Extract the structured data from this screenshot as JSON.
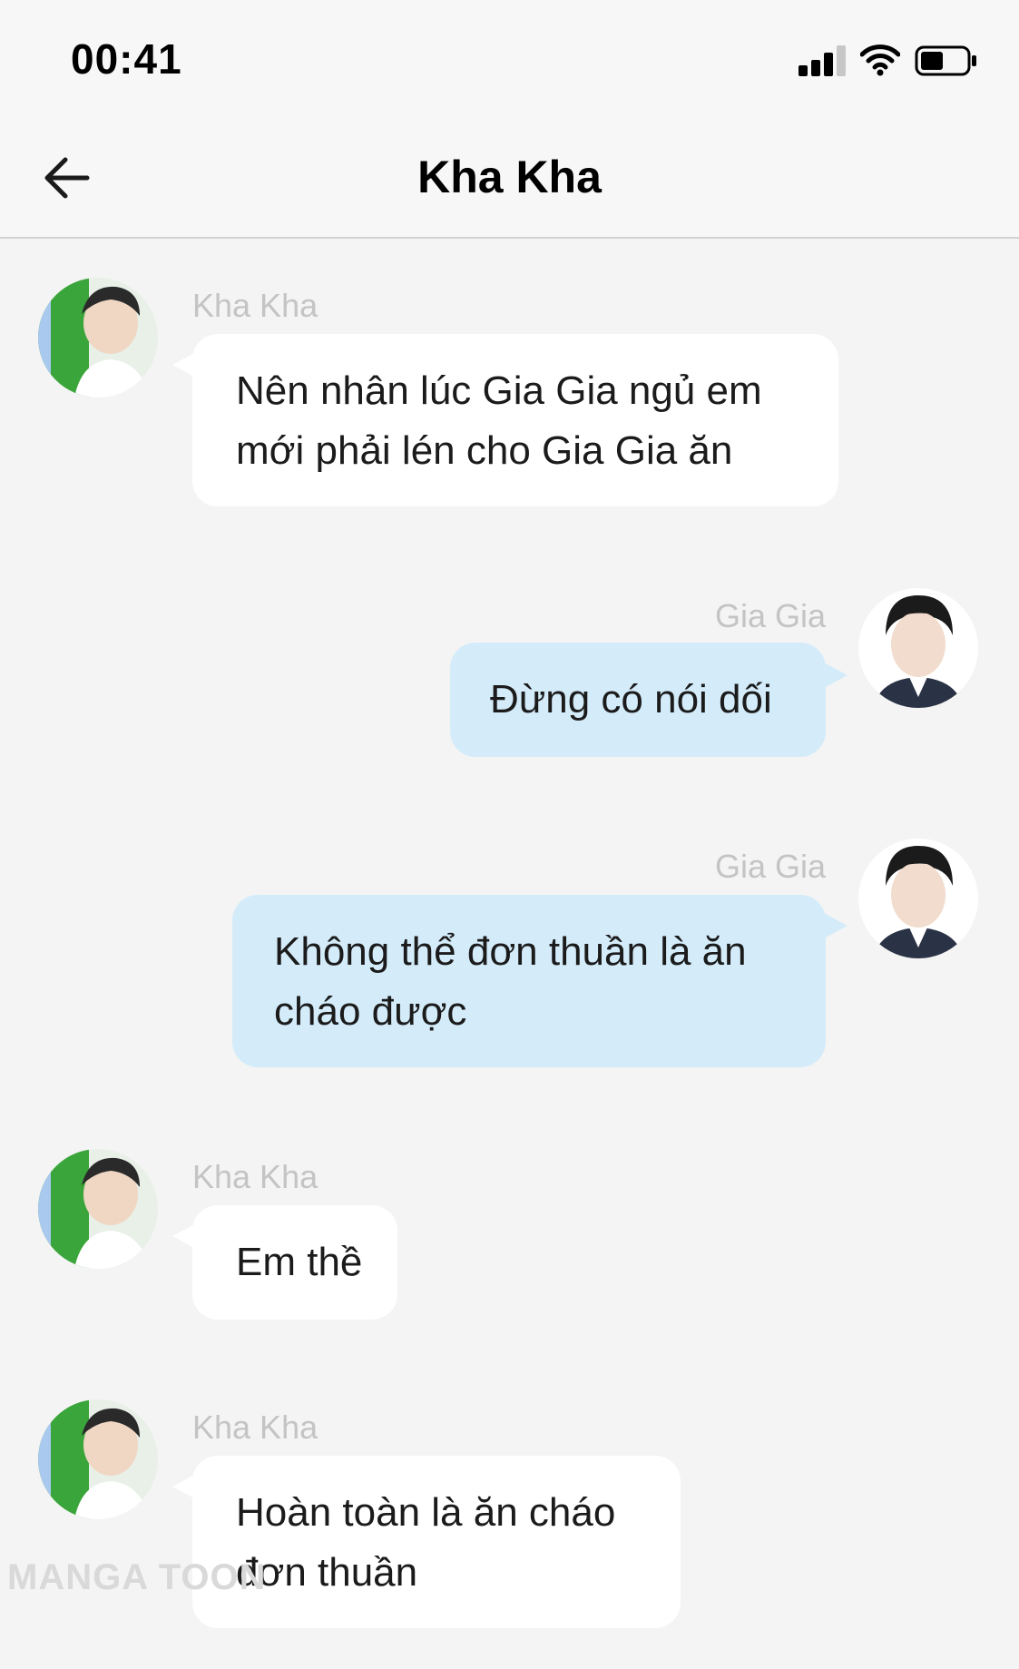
{
  "status_bar": {
    "time": "00:41",
    "signal_icon": "cellular-signal-icon",
    "wifi_icon": "wifi-icon",
    "battery_icon": "battery-icon"
  },
  "nav": {
    "back_icon": "arrow-left-icon",
    "title": "Kha Kha"
  },
  "colors": {
    "background": "#f4f4f4",
    "incoming_bubble": "#ffffff",
    "outgoing_bubble": "#d4ecfa",
    "sender_name": "#c4c4c4"
  },
  "messages": [
    {
      "sender": "Kha Kha",
      "side": "left",
      "text_lines": [
        "Nên nhân lúc Gia Gia ngủ em",
        "mới phải lén cho Gia Gia ăn"
      ]
    },
    {
      "sender": "Gia Gia",
      "side": "right",
      "text_lines": [
        "Đừng có nói dối"
      ]
    },
    {
      "sender": "Gia Gia",
      "side": "right",
      "text_lines": [
        "Không thể đơn thuần là ăn",
        "cháo được"
      ]
    },
    {
      "sender": "Kha Kha",
      "side": "left",
      "text_lines": [
        "Em thề"
      ]
    },
    {
      "sender": "Kha Kha",
      "side": "left",
      "text_lines": [
        "Hoàn toàn là ăn cháo",
        "đơn thuần"
      ]
    }
  ],
  "watermark": "MANGA TOON"
}
